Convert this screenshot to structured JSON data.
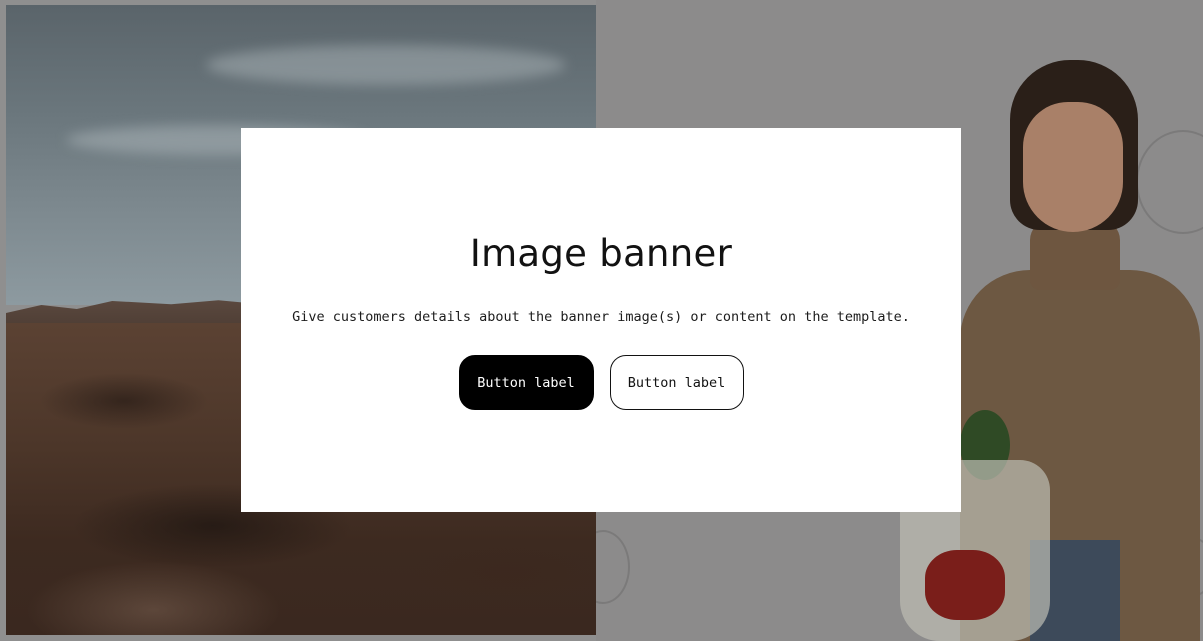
{
  "banner": {
    "heading": "Image banner",
    "description": "Give customers details about the banner image(s) or content on the template.",
    "primary_button_label": "Button label",
    "secondary_button_label": "Button label"
  },
  "images": {
    "left": "landscape-desert-image",
    "right": "woman-with-grocery-bag-image"
  },
  "colors": {
    "overlay": "#8f8f8f",
    "card_background": "#ffffff",
    "primary_button": "#000000",
    "text": "#121212"
  }
}
